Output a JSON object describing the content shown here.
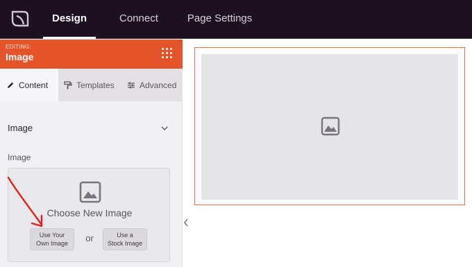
{
  "topbar": {
    "logo_icon": "seedprod-leaf-icon",
    "tabs": [
      {
        "label": "Design",
        "active": true
      },
      {
        "label": "Connect",
        "active": false
      },
      {
        "label": "Page Settings",
        "active": false
      }
    ]
  },
  "sidebar": {
    "editing_label": "EDITING:",
    "editing_title": "Image",
    "subtabs": [
      {
        "label": "Content",
        "icon": "pencil-icon",
        "active": true
      },
      {
        "label": "Templates",
        "icon": "paint-roller-icon",
        "active": false
      },
      {
        "label": "Advanced",
        "icon": "sliders-icon",
        "active": false
      }
    ],
    "section_title": "Image",
    "field_label": "Image",
    "picker": {
      "choose_label": "Choose New Image",
      "own_image_line1": "Use Your",
      "own_image_line2": "Own Image",
      "or_text": "or",
      "stock_image_line1": "Use a",
      "stock_image_line2": "Stock Image"
    }
  },
  "colors": {
    "topbar": "#1d1020",
    "accent": "#e5532a",
    "canvas_border": "#f06f46",
    "annotation_arrow": "#e0201c"
  }
}
